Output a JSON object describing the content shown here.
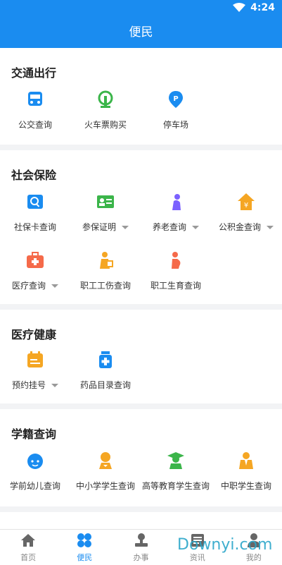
{
  "status": {
    "time": "4:24"
  },
  "header": {
    "title": "便民"
  },
  "sections": [
    {
      "title": "交通出行",
      "items": [
        {
          "label": "公交查询"
        },
        {
          "label": "火车票购买"
        },
        {
          "label": "停车场"
        }
      ]
    },
    {
      "title": "社会保险",
      "items": [
        {
          "label": "社保卡查询"
        },
        {
          "label": "参保证明"
        },
        {
          "label": "养老查询"
        },
        {
          "label": "公积金查询"
        },
        {
          "label": "医疗查询"
        },
        {
          "label": "职工工伤查询"
        },
        {
          "label": "职工生育查询"
        }
      ]
    },
    {
      "title": "医疗健康",
      "items": [
        {
          "label": "预约挂号"
        },
        {
          "label": "药品目录查询"
        }
      ]
    },
    {
      "title": "学籍查询",
      "items": [
        {
          "label": "学前幼儿查询"
        },
        {
          "label": "中小学学生查询"
        },
        {
          "label": "高等教育学生查询"
        },
        {
          "label": "中职学生查询"
        }
      ]
    }
  ],
  "tabbar": {
    "items": [
      {
        "label": "首页"
      },
      {
        "label": "便民"
      },
      {
        "label": "办事"
      },
      {
        "label": "资讯"
      },
      {
        "label": "我的"
      }
    ],
    "active": "便民"
  },
  "watermark": "Downyi.com",
  "colors": {
    "primary": "#1a8cf0",
    "green": "#3bb54a",
    "orange": "#f5a623",
    "purple": "#7b61ff",
    "red": "#f56a4a"
  }
}
